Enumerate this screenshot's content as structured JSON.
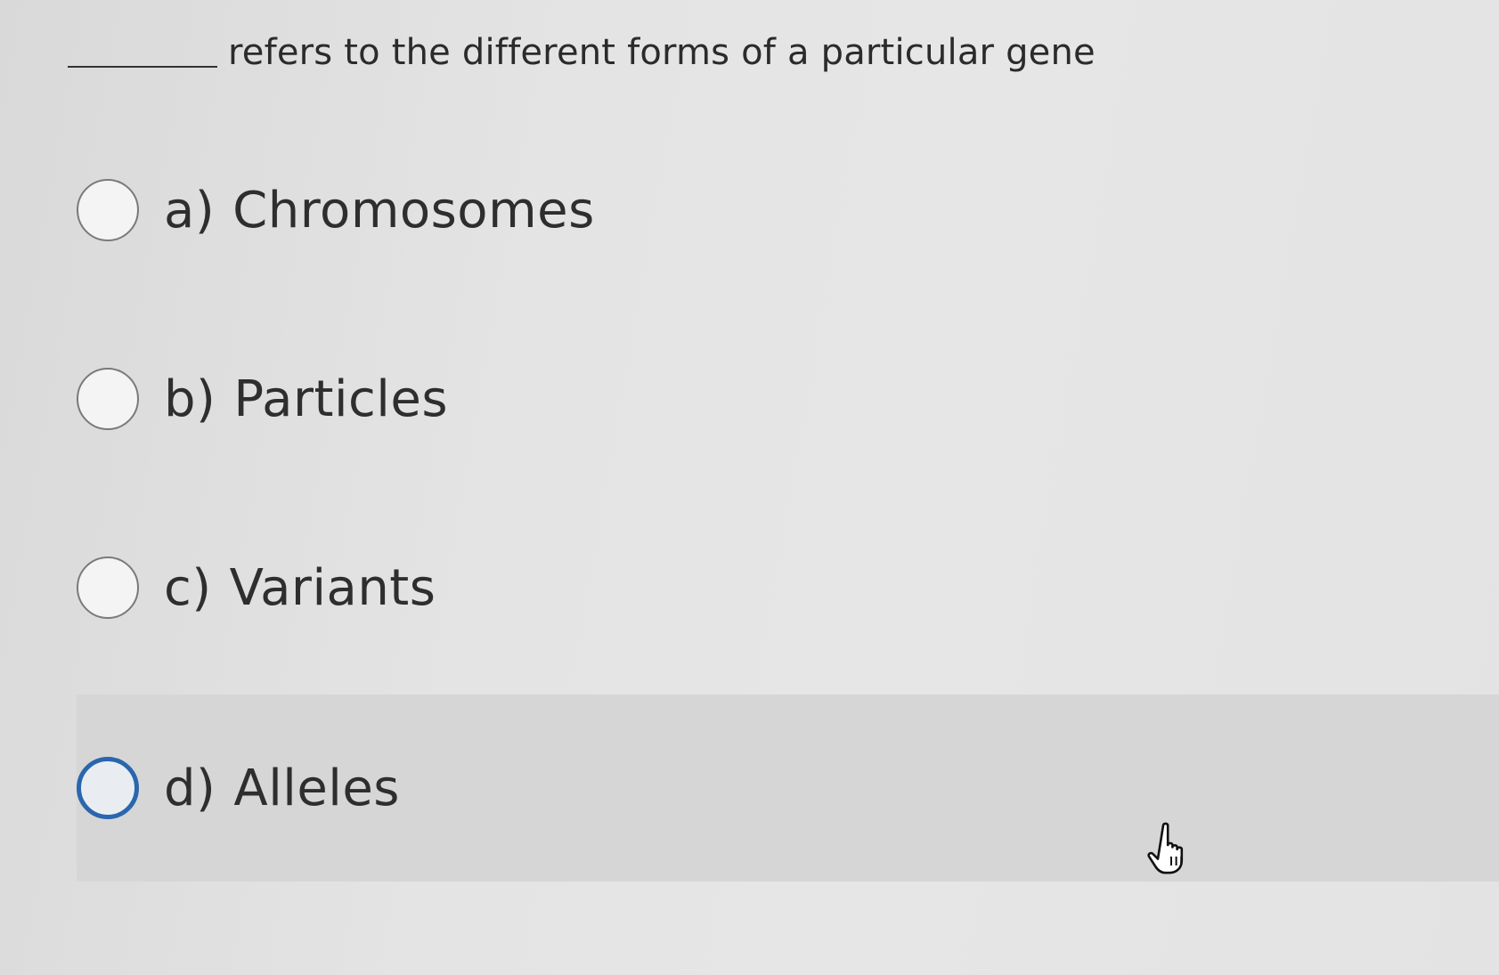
{
  "question": {
    "text": "refers to the different forms of a particular gene"
  },
  "options": [
    {
      "letter": "a)",
      "text": "Chromosomes"
    },
    {
      "letter": "b)",
      "text": "Particles"
    },
    {
      "letter": "c)",
      "text": "Variants"
    },
    {
      "letter": "d)",
      "text": "Alleles"
    }
  ],
  "colors": {
    "background": "#e4e4e4",
    "hover_row": "#d6d6d6",
    "focus_ring": "#2a66ae"
  },
  "icons": {
    "cursor": "hand-pointer-icon"
  }
}
